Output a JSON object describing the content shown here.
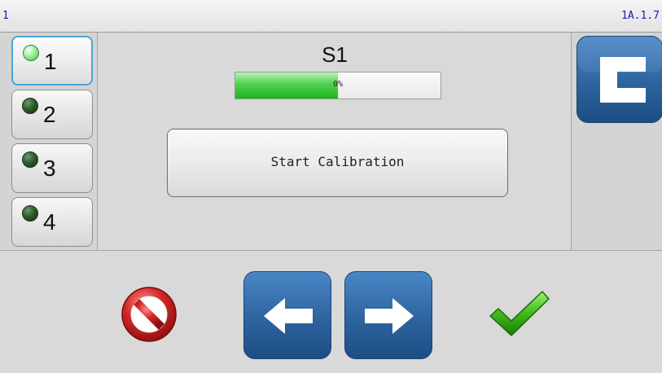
{
  "status_bar": {
    "left_text": "1",
    "right_text": "1A.1.7"
  },
  "channels": [
    {
      "label": "1",
      "led": "on",
      "selected": true
    },
    {
      "label": "2",
      "led": "off",
      "selected": false
    },
    {
      "label": "3",
      "led": "off",
      "selected": false
    },
    {
      "label": "4",
      "led": "off",
      "selected": false
    }
  ],
  "main": {
    "title": "S1",
    "progress": {
      "label": "0%",
      "fill_fraction": 0.5
    },
    "start_button_label": "Start Calibration"
  },
  "right": {
    "icon": "c-letter-icon"
  },
  "bottom": {
    "cancel_icon": "no-entry-icon",
    "prev_icon": "arrow-left-icon",
    "next_icon": "arrow-right-icon",
    "ok_icon": "checkmark-icon"
  },
  "colors": {
    "accent_blue": "#2d649f",
    "led_on": "#a8f0a8",
    "led_off": "#2d5c2d",
    "progress_green": "#1fb41f",
    "cancel_red": "#c62020",
    "ok_green": "#3dbb1a",
    "status_text": "#1a1ab8"
  }
}
